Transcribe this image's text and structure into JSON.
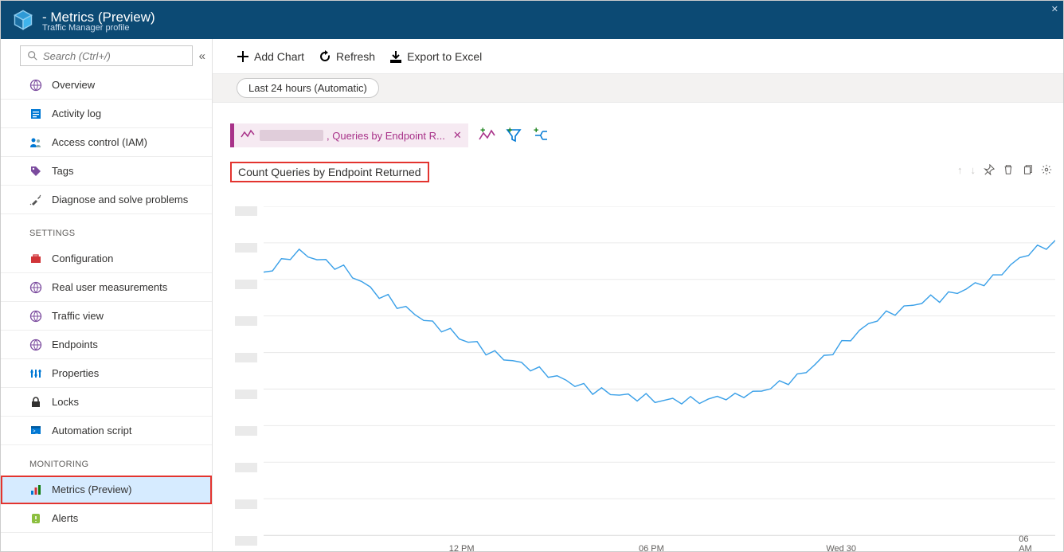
{
  "header": {
    "title": " - Metrics (Preview)",
    "subtitle": "Traffic Manager profile"
  },
  "sidebar": {
    "search_placeholder": "Search (Ctrl+/)",
    "groups": [
      {
        "label": "",
        "items": [
          {
            "label": "Overview",
            "icon": "globe",
            "interact": true
          },
          {
            "label": "Activity log",
            "icon": "log",
            "interact": true
          },
          {
            "label": "Access control (IAM)",
            "icon": "iam",
            "interact": true
          },
          {
            "label": "Tags",
            "icon": "tag",
            "interact": true
          },
          {
            "label": "Diagnose and solve problems",
            "icon": "tools",
            "interact": true
          }
        ]
      },
      {
        "label": "SETTINGS",
        "items": [
          {
            "label": "Configuration",
            "icon": "briefcase",
            "interact": true
          },
          {
            "label": "Real user measurements",
            "icon": "globe",
            "interact": true
          },
          {
            "label": "Traffic view",
            "icon": "globe",
            "interact": true
          },
          {
            "label": "Endpoints",
            "icon": "globe",
            "interact": true
          },
          {
            "label": "Properties",
            "icon": "sliders",
            "interact": true
          },
          {
            "label": "Locks",
            "icon": "lock",
            "interact": true
          },
          {
            "label": "Automation script",
            "icon": "script",
            "interact": true
          }
        ]
      },
      {
        "label": "MONITORING",
        "items": [
          {
            "label": "Metrics (Preview)",
            "icon": "chart",
            "interact": true,
            "selected": true,
            "highlight": true
          },
          {
            "label": "Alerts",
            "icon": "alert",
            "interact": true
          }
        ]
      }
    ]
  },
  "commands": {
    "add_chart": "Add Chart",
    "refresh": "Refresh",
    "export": "Export to Excel"
  },
  "timerange": {
    "label": "Last 24 hours (Automatic)"
  },
  "metric_tag": {
    "text": ", Queries by Endpoint R..."
  },
  "chart_title": "Count Queries by Endpoint Returned",
  "chart_data": {
    "type": "line",
    "title": "Count Queries by Endpoint Returned",
    "xlabel": "",
    "ylabel": "",
    "x_ticks": [
      "12 PM",
      "06 PM",
      "Wed 30",
      "06 AM"
    ],
    "ylim": [
      0,
      100
    ],
    "series": [
      {
        "name": "Queries by Endpoint Returned",
        "values": [
          80,
          81,
          83,
          85,
          86,
          85,
          84,
          83,
          82,
          81,
          79,
          77,
          75,
          73,
          72,
          70,
          69,
          67,
          66,
          64,
          63,
          62,
          60,
          59,
          58,
          56,
          55,
          54,
          53,
          52,
          51,
          50,
          49,
          48,
          47,
          46,
          45,
          44,
          44,
          43,
          43,
          42,
          42,
          42,
          41,
          41,
          41,
          41,
          41,
          41,
          41,
          42,
          42,
          42,
          43,
          43,
          44,
          45,
          46,
          47,
          48,
          50,
          52,
          54,
          56,
          58,
          60,
          62,
          64,
          66,
          67,
          68,
          69,
          70,
          71,
          72,
          72,
          73,
          74,
          75,
          76,
          77,
          78,
          80,
          82,
          84,
          86,
          87,
          88,
          89
        ]
      }
    ]
  }
}
